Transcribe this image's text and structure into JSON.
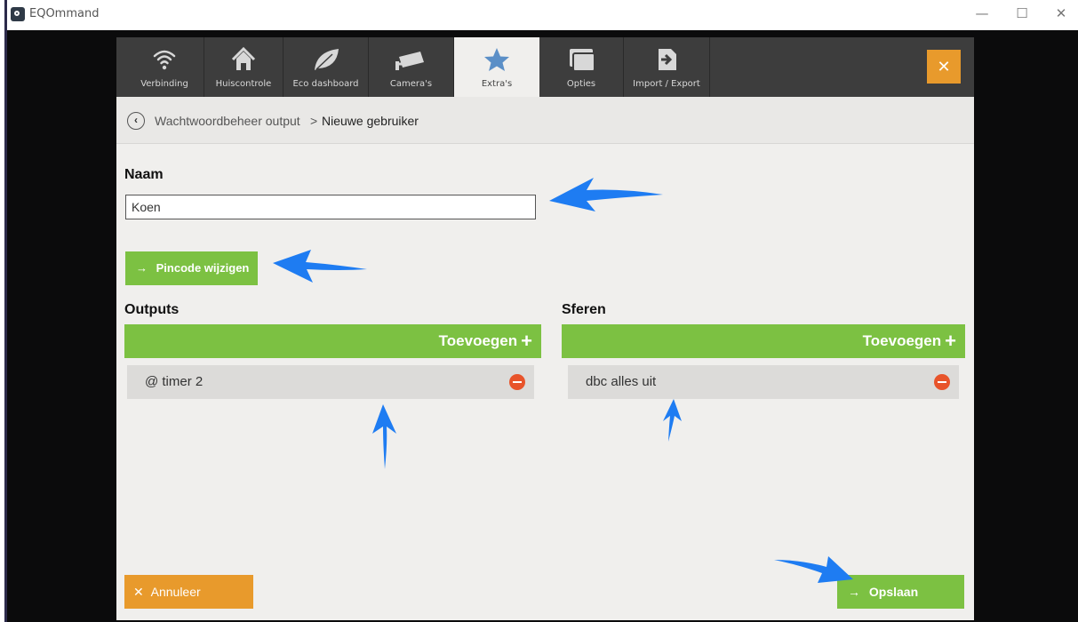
{
  "window": {
    "title": "EQOmmand",
    "minimize_glyph": "—",
    "maximize_glyph": "☐",
    "close_glyph": "✕"
  },
  "tabs": [
    {
      "label": "Verbinding",
      "icon": "wifi-icon",
      "active": false
    },
    {
      "label": "Huiscontrole",
      "icon": "house-icon",
      "active": false
    },
    {
      "label": "Eco dashboard",
      "icon": "leaf-icon",
      "active": false
    },
    {
      "label": "Camera's",
      "icon": "camera-icon",
      "active": false
    },
    {
      "label": "Extra's",
      "icon": "star-icon",
      "active": true
    },
    {
      "label": "Opties",
      "icon": "windows-icon",
      "active": false
    },
    {
      "label": "Import / Export",
      "icon": "import-export-icon",
      "active": false
    }
  ],
  "close_button": {
    "glyph": "✕"
  },
  "breadcrumb": {
    "back_glyph": "‹",
    "parent": "Wachtwoordbeheer output",
    "separator": ">",
    "current": "Nieuwe gebruiker"
  },
  "form": {
    "name_label": "Naam",
    "name_value": "Koen",
    "pin_button_label": "Pincode wijzigen",
    "arrow_glyph": "→"
  },
  "outputs": {
    "heading": "Outputs",
    "add_label": "Toevoegen",
    "add_glyph": "+",
    "items": [
      "@ timer 2"
    ]
  },
  "scenes": {
    "heading": "Sferen",
    "add_label": "Toevoegen",
    "add_glyph": "+",
    "items": [
      "dbc alles uit"
    ]
  },
  "footer": {
    "cancel_glyph": "✕",
    "cancel_label": "Annuleer",
    "save_glyph": "→",
    "save_label": "Opslaan"
  },
  "colors": {
    "accent_green": "#7cc142",
    "accent_orange": "#e89a2c",
    "remove_red": "#e8542b",
    "annotation_blue": "#1e7cf2",
    "tabbar": "#3d3d3d"
  }
}
